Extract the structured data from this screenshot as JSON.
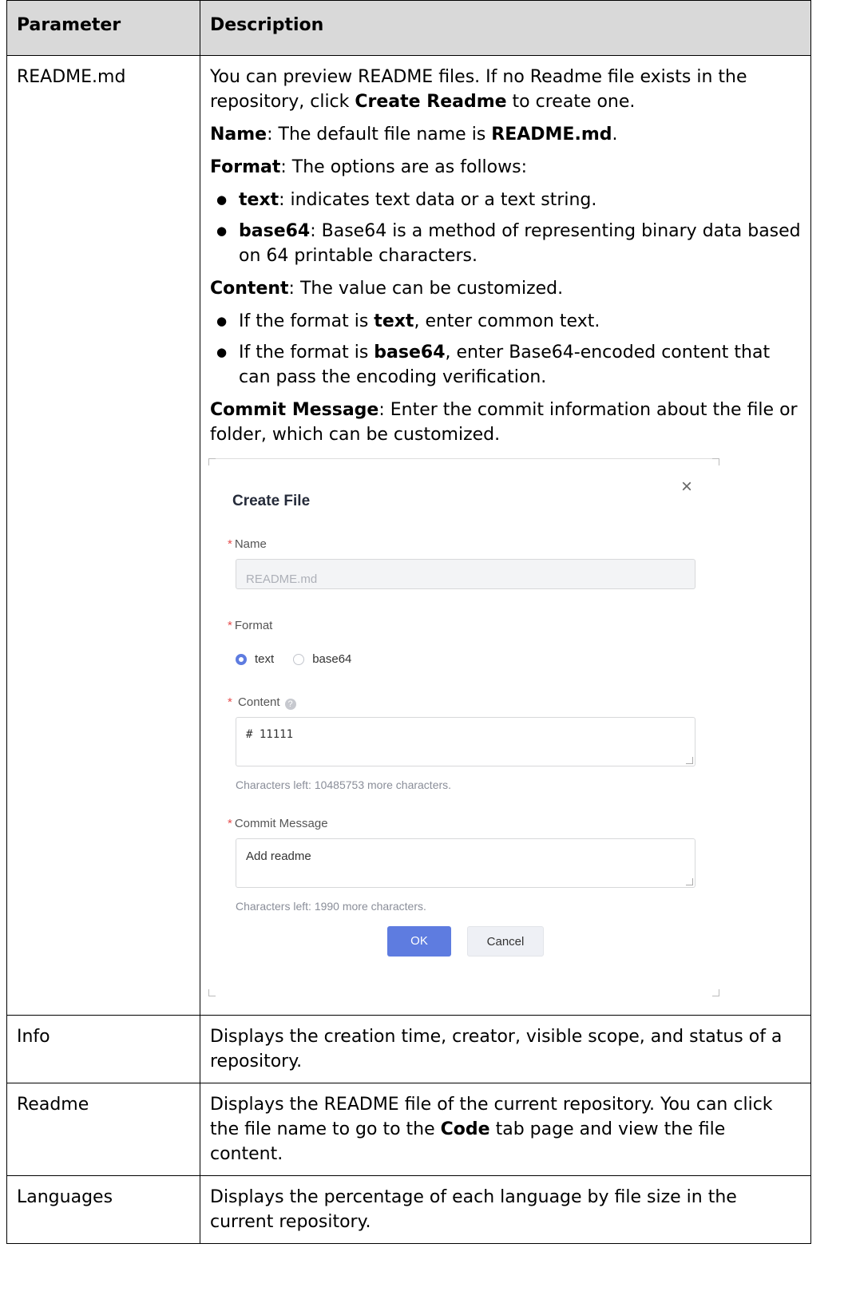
{
  "table": {
    "headers": [
      "Parameter",
      "Description"
    ],
    "readme_row": {
      "param": "README.md",
      "intro_a": "You can preview README files. If no Readme file exists in the repository, click ",
      "intro_b": "Create Readme",
      "intro_c": " to create one.",
      "name_label": "Name",
      "name_text": ": The default file name is ",
      "name_value": "README.md",
      "name_end": ".",
      "format_label": "Format",
      "format_text": ": The options are as follows:",
      "format_items": [
        {
          "term": "text",
          "desc": ": indicates text data or a text string."
        },
        {
          "term": "base64",
          "desc": ": Base64 is a method of representing binary data based on 64 printable characters."
        }
      ],
      "content_label": "Content",
      "content_text": ": The value can be customized.",
      "content_items": [
        {
          "pre": "If the format is ",
          "term": "text",
          "post": ", enter common text."
        },
        {
          "pre": "If the format is ",
          "term": "base64",
          "post": ", enter Base64-encoded content that can pass the encoding verification."
        }
      ],
      "commit_label": "Commit Message",
      "commit_text": ": Enter the commit information about the file or folder, which can be customized."
    },
    "rows": [
      {
        "param": "Info",
        "a": "Displays the creation time, creator, visible scope, and status of a repository."
      },
      {
        "param": "Readme",
        "a": "Displays the README file of the current repository. You can click the file name to go to the ",
        "b": "Code",
        "c": " tab page and view the file content."
      },
      {
        "param": "Languages",
        "a": "Displays the percentage of each language by file size in the current repository."
      }
    ]
  },
  "dialog": {
    "title": "Create File",
    "close_glyph": "×",
    "required_mark": "*",
    "name_label": "Name",
    "name_value": "README.md",
    "format_label": "Format",
    "format_options": [
      "text",
      "base64"
    ],
    "format_selected": "text",
    "content_label": "Content",
    "help_glyph": "?",
    "content_value": "# 11111",
    "content_hint": "Characters left: 10485753 more characters.",
    "commit_label": "Commit Message",
    "commit_value": "Add readme",
    "commit_hint": "Characters left: 1990 more characters.",
    "ok_label": "OK",
    "cancel_label": "Cancel",
    "accent_color": "#5e7ce0"
  }
}
